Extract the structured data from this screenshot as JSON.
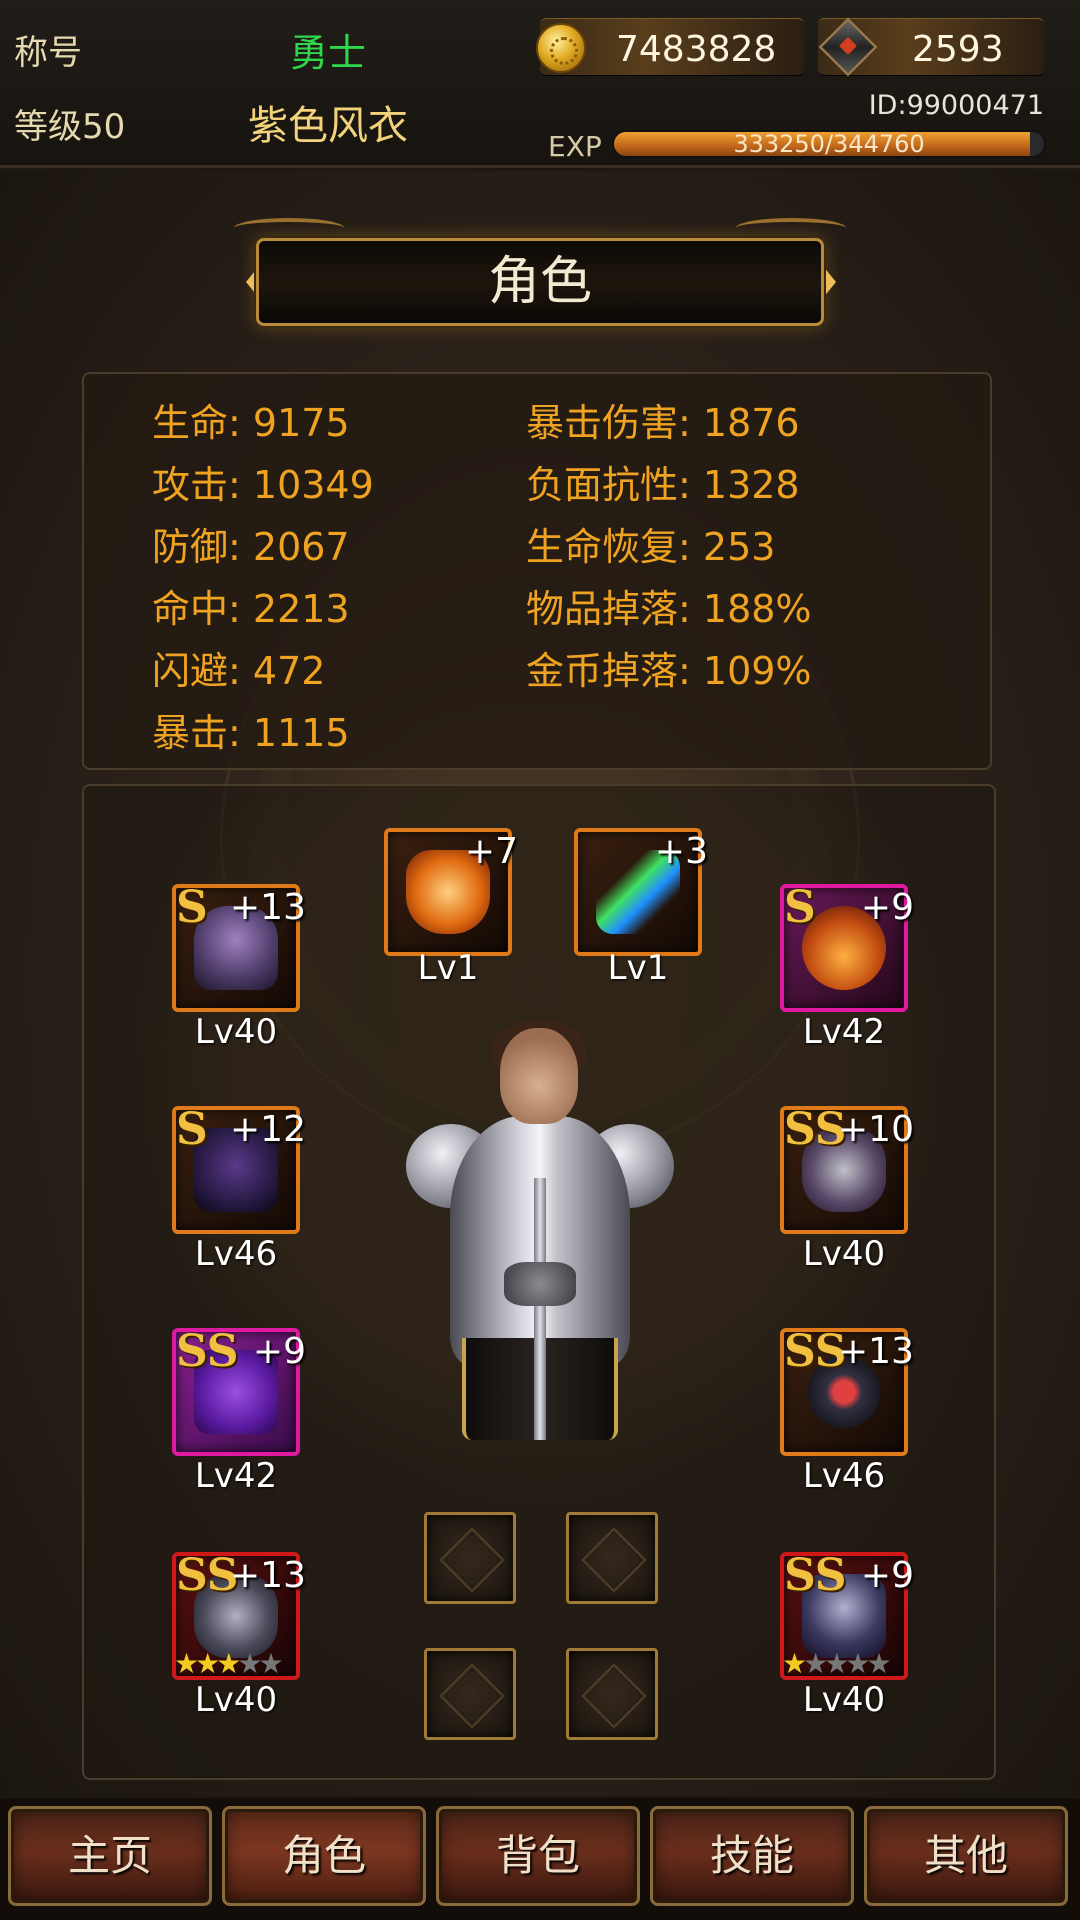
{
  "topbar": {
    "title_label": "称号",
    "title_value": "勇士",
    "level_label": "等级50",
    "equipment_name": "紫色风衣",
    "gold": "7483828",
    "gems": "2593",
    "player_id": "ID:99000471",
    "exp_label": "EXP",
    "exp_text": "333250/344760",
    "exp_fraction": 0.9666
  },
  "page": {
    "title": "角色"
  },
  "stats": {
    "left": [
      {
        "k": "生命",
        "v": ": 9175"
      },
      {
        "k": "攻击",
        "v": ": 10349"
      },
      {
        "k": "防御",
        "v": ": 2067"
      },
      {
        "k": "命中",
        "v": ": 2213"
      },
      {
        "k": "闪避",
        "v": ": 472"
      },
      {
        "k": "暴击",
        "v": ": 1115"
      }
    ],
    "right": [
      {
        "k": "暴击伤害",
        "v": ": 1876"
      },
      {
        "k": "负面抗性",
        "v": ": 1328"
      },
      {
        "k": "生命恢复",
        "v": ": 253"
      },
      {
        "k": "物品掉落",
        "v": ": 188%"
      },
      {
        "k": "金币掉落",
        "v": ": 109%"
      }
    ]
  },
  "equipment": {
    "wings": {
      "grade": "",
      "plus": "+7",
      "level": "Lv1",
      "icon": "butterfly-wings-icon"
    },
    "feather": {
      "grade": "",
      "plus": "+3",
      "level": "Lv1",
      "icon": "feather-icon"
    },
    "helmet": {
      "grade": "S",
      "plus": "+13",
      "level": "Lv40",
      "icon": "helmet-icon"
    },
    "necklace": {
      "grade": "S",
      "plus": "+9",
      "level": "Lv42",
      "icon": "necklace-icon"
    },
    "armor": {
      "grade": "S",
      "plus": "+12",
      "level": "Lv46",
      "icon": "armor-icon"
    },
    "gloves": {
      "grade": "SS",
      "plus": "+10",
      "level": "Lv40",
      "icon": "gauntlet-icon"
    },
    "legs": {
      "grade": "SS",
      "plus": "+9",
      "level": "Lv42",
      "icon": "leg-armor-icon"
    },
    "ring": {
      "grade": "SS",
      "plus": "+13",
      "level": "Lv46",
      "icon": "ring-icon"
    },
    "weapon": {
      "grade": "SS",
      "plus": "+13",
      "level": "Lv40",
      "icon": "gauntlet-weapon-icon",
      "stars": 3,
      "max_stars": 5
    },
    "boots": {
      "grade": "SS",
      "plus": "+9",
      "level": "Lv40",
      "icon": "boots-icon",
      "stars": 1,
      "max_stars": 5
    }
  },
  "nav": {
    "home": "主页",
    "character": "角色",
    "bag": "背包",
    "skills": "技能",
    "other": "其他"
  },
  "colors": {
    "accent_gold": "#f0a320",
    "title_green": "#2fd84a",
    "orange_frame": "#e07a18",
    "pink_frame": "#e01aa0",
    "red_frame": "#d01818"
  }
}
